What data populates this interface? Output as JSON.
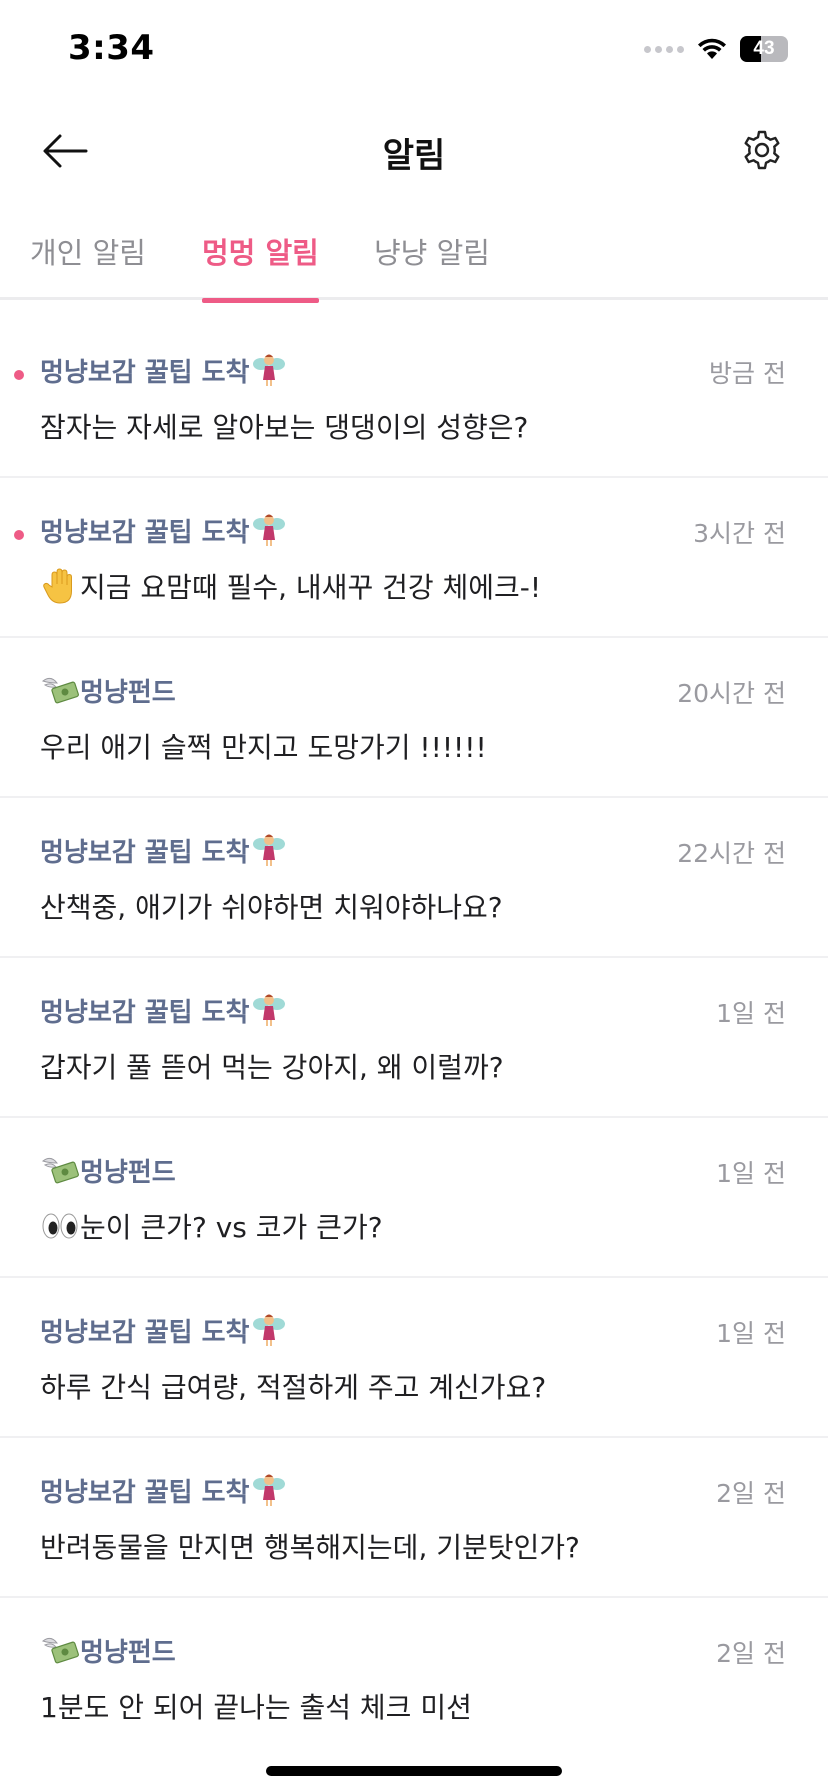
{
  "status_bar": {
    "time": "3:34",
    "battery": "43"
  },
  "header": {
    "title": "알림"
  },
  "tabs": [
    {
      "label": "개인 알림",
      "active": false
    },
    {
      "label": "멍멍 알림",
      "active": true
    },
    {
      "label": "냥냥 알림",
      "active": false
    }
  ],
  "notifications": [
    {
      "sender": "멍냥보감 꿀팁 도착",
      "time": "방금 전",
      "message": "잠자는 자세로 알아보는 댕댕이의 성향은?",
      "unread": true
    },
    {
      "sender": "멍냥보감 꿀팁 도착",
      "time": "3시간 전",
      "message": "지금 요맘때 필수, 내새꾸 건강 체에크-!",
      "unread": true
    },
    {
      "sender": "멍냥펀드",
      "time": "20시간 전",
      "message": "우리 애기 슬쩍 만지고 도망가기 !!!!!!",
      "unread": false
    },
    {
      "sender": "멍냥보감 꿀팁 도착",
      "time": "22시간 전",
      "message": "산책중, 애기가 쉬야하면 치워야하나요?",
      "unread": false
    },
    {
      "sender": "멍냥보감 꿀팁 도착",
      "time": "1일 전",
      "message": "갑자기 풀 뜯어 먹는 강아지, 왜 이럴까?",
      "unread": false
    },
    {
      "sender": "멍냥펀드",
      "time": "1일 전",
      "message": "눈이 큰가? vs 코가 큰가?",
      "unread": false
    },
    {
      "sender": "멍냥보감 꿀팁 도착",
      "time": "1일 전",
      "message": "하루 간식 급여량, 적절하게 주고 계신가요?",
      "unread": false
    },
    {
      "sender": "멍냥보감 꿀팁 도착",
      "time": "2일 전",
      "message": "반려동물을 만지면 행복해지는데, 기분탓인가?",
      "unread": false
    },
    {
      "sender": "멍냥펀드",
      "time": "2일 전",
      "message": "1분도 안 되어 끝나는 출석 체크 미션",
      "unread": false
    }
  ],
  "icons": {
    "tip": "fairy-icon",
    "fund": "money-wings-icon",
    "hand": "raised-hand-icon",
    "eyes": "eyes-icon"
  },
  "colors": {
    "accent": "#ee5b86",
    "sender": "#5f6d8e"
  }
}
